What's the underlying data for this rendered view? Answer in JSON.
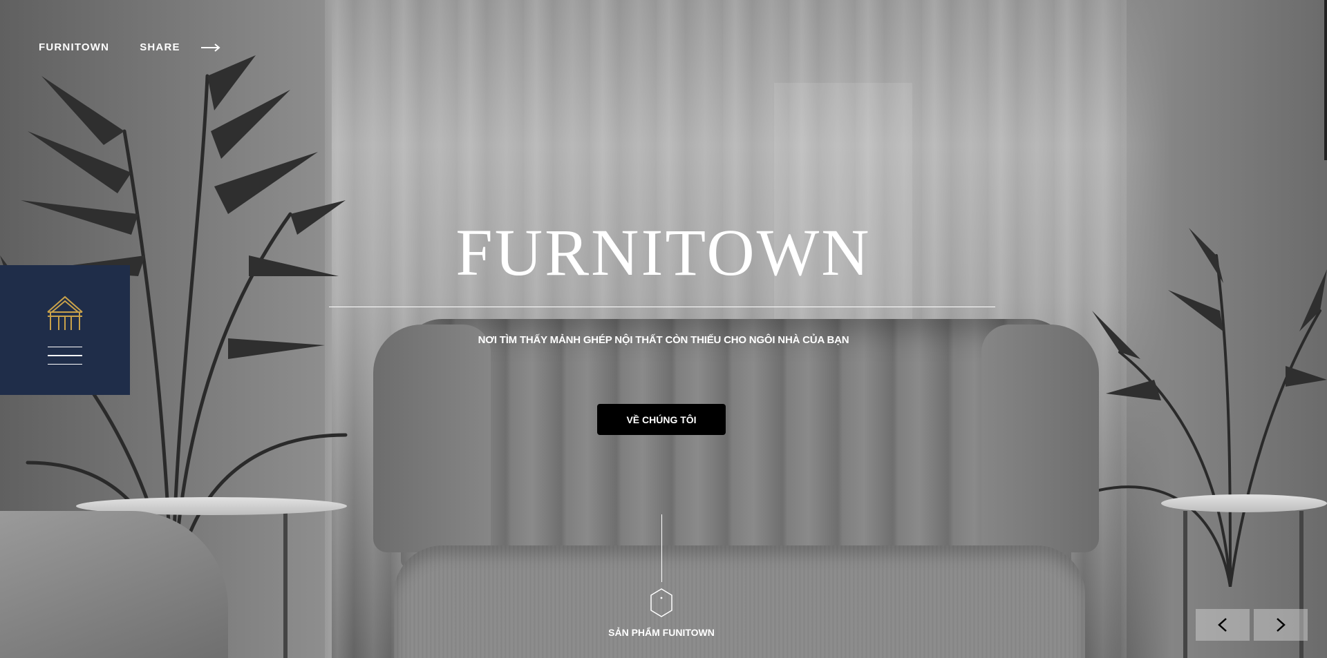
{
  "nav": {
    "brand": "FURNITOWN",
    "share": "SHARE",
    "share_icon": "arrow-right-icon"
  },
  "side_menu": {
    "logo_icon": "house-logo-icon",
    "menu_icon": "hamburger-icon",
    "accent_color": "#c9a24a",
    "background": "#1f2d49"
  },
  "hero": {
    "title": "FURNITOWN",
    "subtitle": "NƠI TÌM THẤY MẢNH GHÉP NỘI THẤT CÒN THIẾU CHO NGÔI NHÀ CỦA BẠN",
    "cta": "VỀ CHÚNG TÔI",
    "scroll_label": "SẢN PHẨM FUNITOWN",
    "scroll_icon": "hexagon-icon"
  },
  "slider": {
    "prev_icon": "chevron-left-icon",
    "next_icon": "chevron-right-icon"
  }
}
